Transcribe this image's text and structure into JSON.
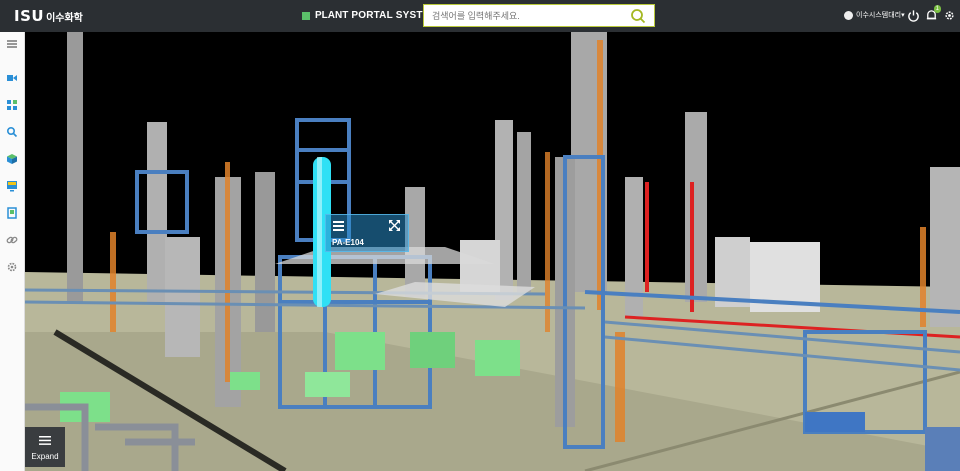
{
  "header": {
    "logo_mark": "ISU",
    "logo_text": "이수화학",
    "portal_bold": "PLANT",
    "portal_rest": "PORTAL SYSTEM",
    "search_placeholder": "검색어를 입력해주세요.",
    "user_name": "이수시스템대리",
    "notification_count": "1"
  },
  "sidebar": {
    "items": [
      "menu-icon",
      "video-icon",
      "grid-icon",
      "search-icon",
      "cube-icon",
      "monitor-icon",
      "document-icon",
      "link-icon",
      "gear-icon"
    ]
  },
  "viewer": {
    "selected_equipment": "PA-E104",
    "expand_label": "Expand"
  },
  "colors": {
    "header_bg": "#2b2f33",
    "accent_green": "#5bbf6a",
    "search_border": "#b9c93a",
    "selection_cyan": "#2fe0f5"
  }
}
